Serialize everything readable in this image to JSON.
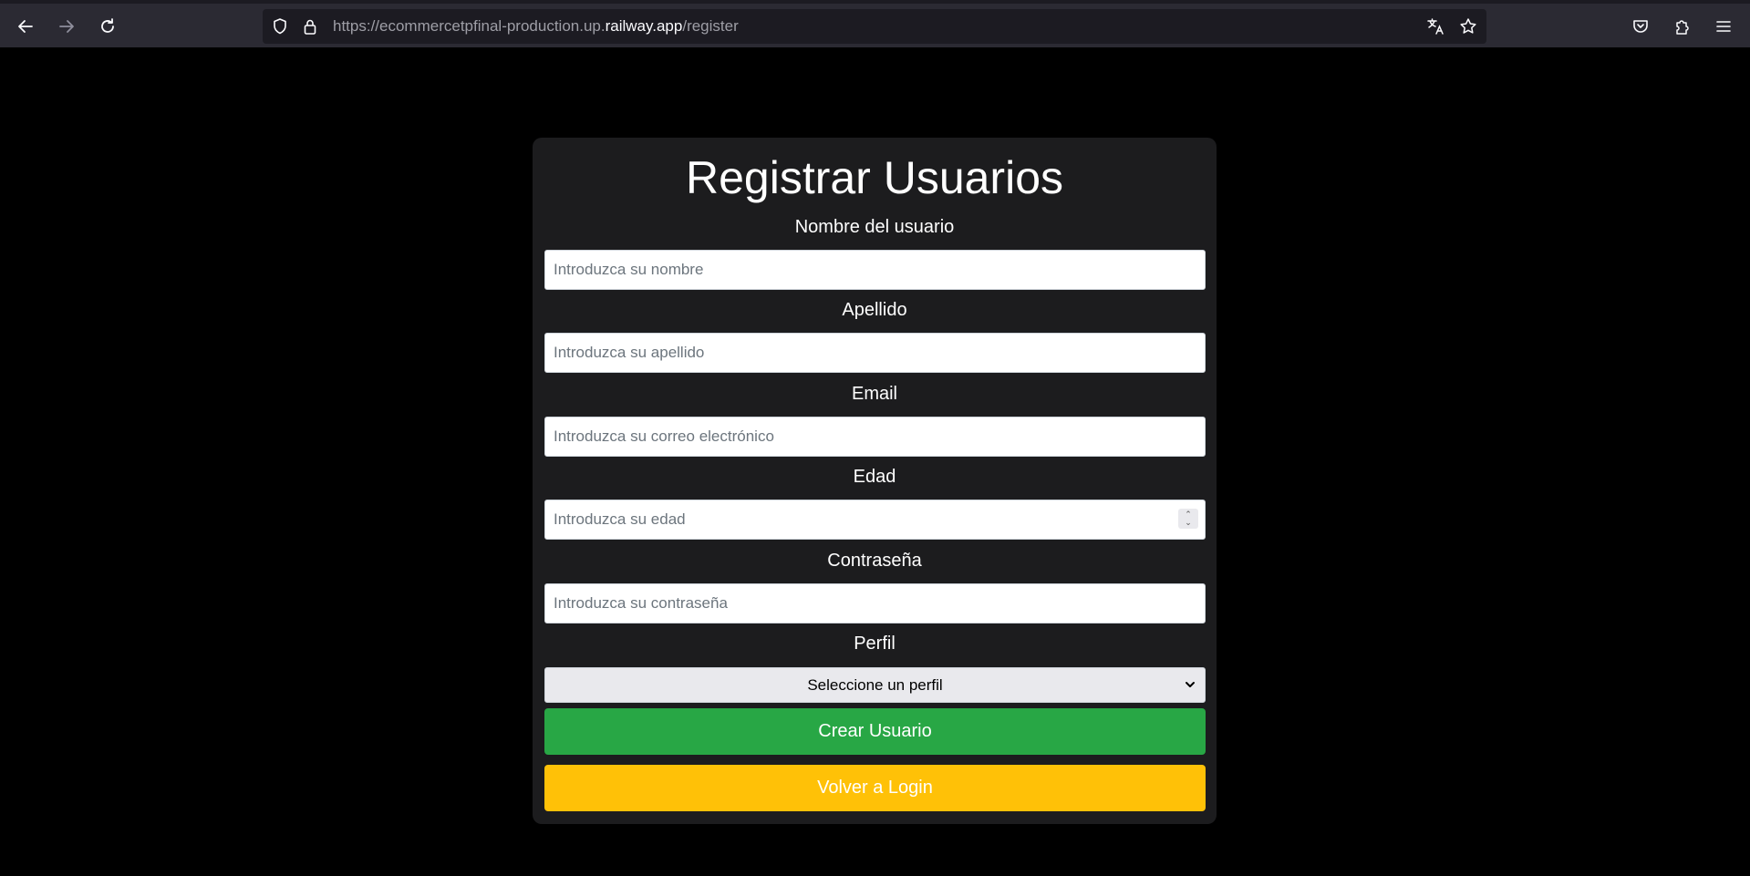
{
  "browser": {
    "url_prefix": "https://ecommercetpfinal-production.up.",
    "url_host": "railway.app",
    "url_path": "/register"
  },
  "form": {
    "title": "Registrar Usuarios",
    "fields": [
      {
        "label": "Nombre del usuario",
        "placeholder": "Introduzca su nombre",
        "value": ""
      },
      {
        "label": "Apellido",
        "placeholder": "Introduzca su apellido",
        "value": ""
      },
      {
        "label": "Email",
        "placeholder": "Introduzca su correo electrónico",
        "value": ""
      },
      {
        "label": "Edad",
        "placeholder": "Introduzca su edad",
        "value": ""
      },
      {
        "label": "Contraseña",
        "placeholder": "Introduzca su contraseña",
        "value": ""
      }
    ],
    "profile_label": "Perfil",
    "profile_selected": "Seleccione un perfil",
    "submit_label": "Crear Usuario",
    "back_label": "Volver a Login"
  },
  "colors": {
    "page_bg": "#000000",
    "card_bg": "#1c1c1e",
    "submit_bg": "#28a745",
    "back_bg": "#ffc107"
  },
  "icons": [
    "back-arrow-icon",
    "forward-arrow-icon",
    "reload-icon",
    "shield-icon",
    "lock-icon",
    "translate-icon",
    "star-icon",
    "pocket-icon",
    "extensions-icon",
    "menu-icon",
    "chevron-down-icon"
  ]
}
